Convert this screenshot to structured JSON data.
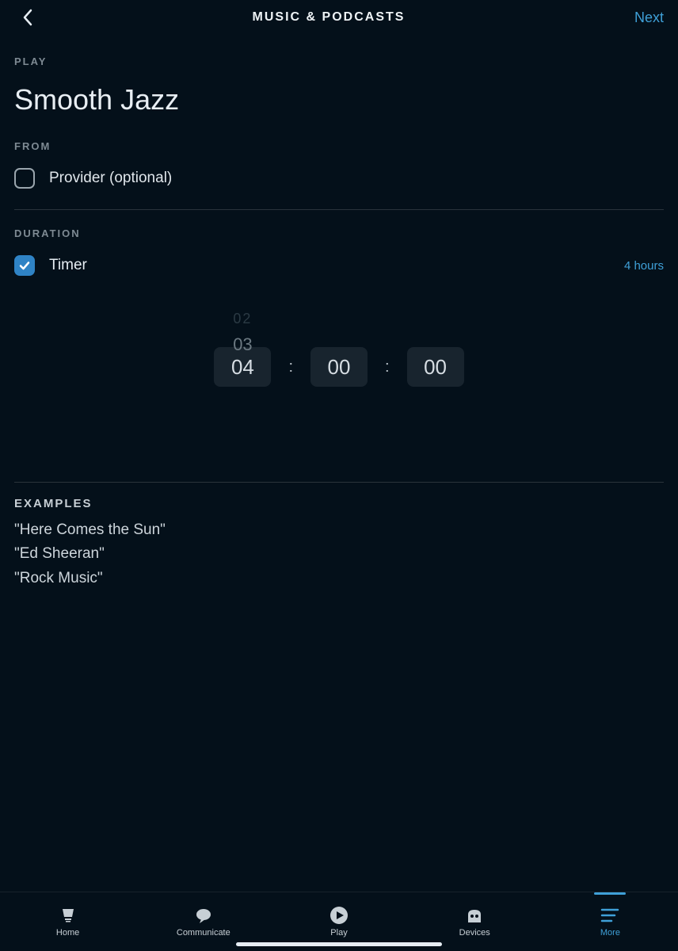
{
  "header": {
    "title": "MUSIC & PODCASTS",
    "next": "Next"
  },
  "play": {
    "label": "PLAY",
    "value": "Smooth Jazz"
  },
  "from": {
    "label": "FROM",
    "provider": "Provider (optional)"
  },
  "duration": {
    "label": "DURATION",
    "timer_label": "Timer",
    "timer_value": "4 hours",
    "picker_above2": "02",
    "picker_above1": "03",
    "hours": "04",
    "minutes": "00",
    "seconds": "00",
    "sep": ":"
  },
  "examples": {
    "label": "EXAMPLES",
    "items": [
      "\"Here Comes the Sun\"",
      "\"Ed Sheeran\"",
      "\"Rock Music\""
    ]
  },
  "tabs": {
    "home": "Home",
    "communicate": "Communicate",
    "play": "Play",
    "devices": "Devices",
    "more": "More"
  }
}
